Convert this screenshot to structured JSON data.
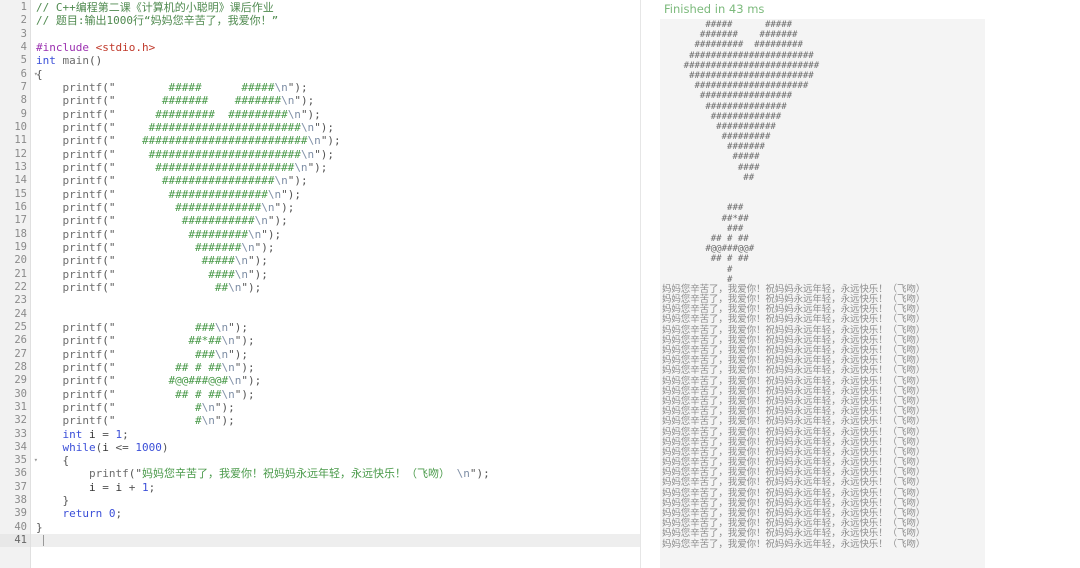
{
  "app": {
    "editor_language": "C",
    "line_count": 41,
    "active_line": 41,
    "fold_lines": [
      6,
      35
    ],
    "colors": {
      "comment": "#4f8a4f",
      "keyword": "#3b4fd8",
      "string": "#4a9a4a",
      "preprocessor": "#9b30b0",
      "include_path": "#c0392b",
      "function": "#6d6d6d",
      "escape": "#7f8fa6",
      "gutter_bg": "#f2f2f2",
      "console_bg": "#f4f4f4",
      "status_green": "#7cba7c"
    }
  },
  "gutter": {
    "numbers": [
      1,
      2,
      3,
      4,
      5,
      6,
      7,
      8,
      9,
      10,
      11,
      12,
      13,
      14,
      15,
      16,
      17,
      18,
      19,
      20,
      21,
      22,
      23,
      24,
      25,
      26,
      27,
      28,
      29,
      30,
      31,
      32,
      33,
      34,
      35,
      36,
      37,
      38,
      39,
      40,
      41
    ]
  },
  "code": {
    "lines": [
      [
        {
          "t": "comment",
          "s": "// C++编程第二课《计算机的小聪明》课后作业"
        }
      ],
      [
        {
          "t": "comment",
          "s": "// 题目:输出1000行“妈妈您辛苦了，我爱你！”"
        }
      ],
      [],
      [
        {
          "t": "pre",
          "s": "#include "
        },
        {
          "t": "inc",
          "s": "<stdio.h>"
        }
      ],
      [
        {
          "t": "kw",
          "s": "int"
        },
        {
          "t": "plain",
          "s": " "
        },
        {
          "t": "fn",
          "s": "main"
        },
        {
          "t": "punct",
          "s": "()"
        }
      ],
      [
        {
          "t": "punct",
          "s": "{"
        }
      ],
      [
        {
          "t": "plain",
          "s": "    "
        },
        {
          "t": "fn",
          "s": "printf"
        },
        {
          "t": "punct",
          "s": "(\""
        },
        {
          "t": "str",
          "s": "        #####      #####"
        },
        {
          "t": "esc",
          "s": "\\n"
        },
        {
          "t": "punct",
          "s": "\");"
        }
      ],
      [
        {
          "t": "plain",
          "s": "    "
        },
        {
          "t": "fn",
          "s": "printf"
        },
        {
          "t": "punct",
          "s": "(\""
        },
        {
          "t": "str",
          "s": "       #######    #######"
        },
        {
          "t": "esc",
          "s": "\\n"
        },
        {
          "t": "punct",
          "s": "\");"
        }
      ],
      [
        {
          "t": "plain",
          "s": "    "
        },
        {
          "t": "fn",
          "s": "printf"
        },
        {
          "t": "punct",
          "s": "(\""
        },
        {
          "t": "str",
          "s": "      #########  #########"
        },
        {
          "t": "esc",
          "s": "\\n"
        },
        {
          "t": "punct",
          "s": "\");"
        }
      ],
      [
        {
          "t": "plain",
          "s": "    "
        },
        {
          "t": "fn",
          "s": "printf"
        },
        {
          "t": "punct",
          "s": "(\""
        },
        {
          "t": "str",
          "s": "     #######################"
        },
        {
          "t": "esc",
          "s": "\\n"
        },
        {
          "t": "punct",
          "s": "\");"
        }
      ],
      [
        {
          "t": "plain",
          "s": "    "
        },
        {
          "t": "fn",
          "s": "printf"
        },
        {
          "t": "punct",
          "s": "(\""
        },
        {
          "t": "str",
          "s": "    #########################"
        },
        {
          "t": "esc",
          "s": "\\n"
        },
        {
          "t": "punct",
          "s": "\");"
        }
      ],
      [
        {
          "t": "plain",
          "s": "    "
        },
        {
          "t": "fn",
          "s": "printf"
        },
        {
          "t": "punct",
          "s": "(\""
        },
        {
          "t": "str",
          "s": "     #######################"
        },
        {
          "t": "esc",
          "s": "\\n"
        },
        {
          "t": "punct",
          "s": "\");"
        }
      ],
      [
        {
          "t": "plain",
          "s": "    "
        },
        {
          "t": "fn",
          "s": "printf"
        },
        {
          "t": "punct",
          "s": "(\""
        },
        {
          "t": "str",
          "s": "      #####################"
        },
        {
          "t": "esc",
          "s": "\\n"
        },
        {
          "t": "punct",
          "s": "\");"
        }
      ],
      [
        {
          "t": "plain",
          "s": "    "
        },
        {
          "t": "fn",
          "s": "printf"
        },
        {
          "t": "punct",
          "s": "(\""
        },
        {
          "t": "str",
          "s": "       #################"
        },
        {
          "t": "esc",
          "s": "\\n"
        },
        {
          "t": "punct",
          "s": "\");"
        }
      ],
      [
        {
          "t": "plain",
          "s": "    "
        },
        {
          "t": "fn",
          "s": "printf"
        },
        {
          "t": "punct",
          "s": "(\""
        },
        {
          "t": "str",
          "s": "        ###############"
        },
        {
          "t": "esc",
          "s": "\\n"
        },
        {
          "t": "punct",
          "s": "\");"
        }
      ],
      [
        {
          "t": "plain",
          "s": "    "
        },
        {
          "t": "fn",
          "s": "printf"
        },
        {
          "t": "punct",
          "s": "(\""
        },
        {
          "t": "str",
          "s": "         #############"
        },
        {
          "t": "esc",
          "s": "\\n"
        },
        {
          "t": "punct",
          "s": "\");"
        }
      ],
      [
        {
          "t": "plain",
          "s": "    "
        },
        {
          "t": "fn",
          "s": "printf"
        },
        {
          "t": "punct",
          "s": "(\""
        },
        {
          "t": "str",
          "s": "          ###########"
        },
        {
          "t": "esc",
          "s": "\\n"
        },
        {
          "t": "punct",
          "s": "\");"
        }
      ],
      [
        {
          "t": "plain",
          "s": "    "
        },
        {
          "t": "fn",
          "s": "printf"
        },
        {
          "t": "punct",
          "s": "(\""
        },
        {
          "t": "str",
          "s": "           #########"
        },
        {
          "t": "esc",
          "s": "\\n"
        },
        {
          "t": "punct",
          "s": "\");"
        }
      ],
      [
        {
          "t": "plain",
          "s": "    "
        },
        {
          "t": "fn",
          "s": "printf"
        },
        {
          "t": "punct",
          "s": "(\""
        },
        {
          "t": "str",
          "s": "            #######"
        },
        {
          "t": "esc",
          "s": "\\n"
        },
        {
          "t": "punct",
          "s": "\");"
        }
      ],
      [
        {
          "t": "plain",
          "s": "    "
        },
        {
          "t": "fn",
          "s": "printf"
        },
        {
          "t": "punct",
          "s": "(\""
        },
        {
          "t": "str",
          "s": "             #####"
        },
        {
          "t": "esc",
          "s": "\\n"
        },
        {
          "t": "punct",
          "s": "\");"
        }
      ],
      [
        {
          "t": "plain",
          "s": "    "
        },
        {
          "t": "fn",
          "s": "printf"
        },
        {
          "t": "punct",
          "s": "(\""
        },
        {
          "t": "str",
          "s": "              ####"
        },
        {
          "t": "esc",
          "s": "\\n"
        },
        {
          "t": "punct",
          "s": "\");"
        }
      ],
      [
        {
          "t": "plain",
          "s": "    "
        },
        {
          "t": "fn",
          "s": "printf"
        },
        {
          "t": "punct",
          "s": "(\""
        },
        {
          "t": "str",
          "s": "               ##"
        },
        {
          "t": "esc",
          "s": "\\n"
        },
        {
          "t": "punct",
          "s": "\");"
        }
      ],
      [],
      [],
      [
        {
          "t": "plain",
          "s": "    "
        },
        {
          "t": "fn",
          "s": "printf"
        },
        {
          "t": "punct",
          "s": "(\""
        },
        {
          "t": "str",
          "s": "            ###"
        },
        {
          "t": "esc",
          "s": "\\n"
        },
        {
          "t": "punct",
          "s": "\");"
        }
      ],
      [
        {
          "t": "plain",
          "s": "    "
        },
        {
          "t": "fn",
          "s": "printf"
        },
        {
          "t": "punct",
          "s": "(\""
        },
        {
          "t": "str",
          "s": "           ##*##"
        },
        {
          "t": "esc",
          "s": "\\n"
        },
        {
          "t": "punct",
          "s": "\");"
        }
      ],
      [
        {
          "t": "plain",
          "s": "    "
        },
        {
          "t": "fn",
          "s": "printf"
        },
        {
          "t": "punct",
          "s": "(\""
        },
        {
          "t": "str",
          "s": "            ###"
        },
        {
          "t": "esc",
          "s": "\\n"
        },
        {
          "t": "punct",
          "s": "\");"
        }
      ],
      [
        {
          "t": "plain",
          "s": "    "
        },
        {
          "t": "fn",
          "s": "printf"
        },
        {
          "t": "punct",
          "s": "(\""
        },
        {
          "t": "str",
          "s": "         ## # ##"
        },
        {
          "t": "esc",
          "s": "\\n"
        },
        {
          "t": "punct",
          "s": "\");"
        }
      ],
      [
        {
          "t": "plain",
          "s": "    "
        },
        {
          "t": "fn",
          "s": "printf"
        },
        {
          "t": "punct",
          "s": "(\""
        },
        {
          "t": "str",
          "s": "        #@@###@@#"
        },
        {
          "t": "esc",
          "s": "\\n"
        },
        {
          "t": "punct",
          "s": "\");"
        }
      ],
      [
        {
          "t": "plain",
          "s": "    "
        },
        {
          "t": "fn",
          "s": "printf"
        },
        {
          "t": "punct",
          "s": "(\""
        },
        {
          "t": "str",
          "s": "         ## # ##"
        },
        {
          "t": "esc",
          "s": "\\n"
        },
        {
          "t": "punct",
          "s": "\");"
        }
      ],
      [
        {
          "t": "plain",
          "s": "    "
        },
        {
          "t": "fn",
          "s": "printf"
        },
        {
          "t": "punct",
          "s": "(\""
        },
        {
          "t": "str",
          "s": "            #"
        },
        {
          "t": "esc",
          "s": "\\n"
        },
        {
          "t": "punct",
          "s": "\");"
        }
      ],
      [
        {
          "t": "plain",
          "s": "    "
        },
        {
          "t": "fn",
          "s": "printf"
        },
        {
          "t": "punct",
          "s": "(\""
        },
        {
          "t": "str",
          "s": "            #"
        },
        {
          "t": "esc",
          "s": "\\n"
        },
        {
          "t": "punct",
          "s": "\");"
        }
      ],
      [
        {
          "t": "plain",
          "s": "    "
        },
        {
          "t": "kw",
          "s": "int"
        },
        {
          "t": "plain",
          "s": " i "
        },
        {
          "t": "punct",
          "s": "= "
        },
        {
          "t": "num",
          "s": "1"
        },
        {
          "t": "punct",
          "s": ";"
        }
      ],
      [
        {
          "t": "plain",
          "s": "    "
        },
        {
          "t": "kw",
          "s": "while"
        },
        {
          "t": "punct",
          "s": "("
        },
        {
          "t": "plain",
          "s": "i "
        },
        {
          "t": "punct",
          "s": "<= "
        },
        {
          "t": "num",
          "s": "1000"
        },
        {
          "t": "punct",
          "s": ")"
        }
      ],
      [
        {
          "t": "plain",
          "s": "    "
        },
        {
          "t": "punct",
          "s": "{"
        }
      ],
      [
        {
          "t": "plain",
          "s": "        "
        },
        {
          "t": "fn",
          "s": "printf"
        },
        {
          "t": "punct",
          "s": "(\""
        },
        {
          "t": "strcn",
          "s": "妈妈您辛苦了，我爱你！祝妈妈永远年轻，永远快乐！（飞吻）"
        },
        {
          "t": "esc",
          "s": " \\n"
        },
        {
          "t": "punct",
          "s": "\");"
        }
      ],
      [
        {
          "t": "plain",
          "s": "        i "
        },
        {
          "t": "punct",
          "s": "= "
        },
        {
          "t": "plain",
          "s": "i "
        },
        {
          "t": "punct",
          "s": "+ "
        },
        {
          "t": "num",
          "s": "1"
        },
        {
          "t": "punct",
          "s": ";"
        }
      ],
      [
        {
          "t": "plain",
          "s": "    "
        },
        {
          "t": "punct",
          "s": "}"
        }
      ],
      [
        {
          "t": "plain",
          "s": "    "
        },
        {
          "t": "kw",
          "s": "return"
        },
        {
          "t": "plain",
          "s": " "
        },
        {
          "t": "num",
          "s": "0"
        },
        {
          "t": "punct",
          "s": ";"
        }
      ],
      [
        {
          "t": "punct",
          "s": "}"
        }
      ],
      []
    ]
  },
  "output": {
    "status_text": "Finished in 43 ms",
    "ascii_art": [
      "        #####      #####",
      "       #######    #######",
      "      #########  #########",
      "     #######################",
      "    #########################",
      "     #######################",
      "      #####################",
      "       #################",
      "        ###############",
      "         #############",
      "          ###########",
      "           #########",
      "            #######",
      "             #####",
      "              ####",
      "               ##",
      "",
      "",
      "            ###",
      "           ##*##",
      "            ###",
      "         ## # ##",
      "        #@@###@@#",
      "         ## # ##",
      "            #",
      "            #"
    ],
    "repeated_message": "妈妈您辛苦了，我爱你！祝妈妈永远年轻，永远快乐！（飞吻）",
    "repeated_message_visible_count": 26
  }
}
